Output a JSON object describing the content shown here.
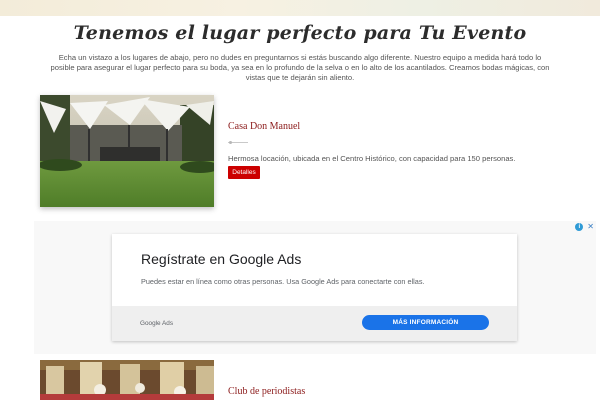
{
  "header": {
    "title": "Tenemos el lugar perfecto para Tu Evento",
    "intro": "Echa un vistazo a los lugares de abajo, pero no dudes en preguntarnos si estás buscando algo diferente. Nuestro equipo a medida hará todo lo posible para asegurar el lugar perfecto para su boda, ya sea en lo profundo de la selva o en lo alto de los acantilados. Creamos bodas mágicas, con vistas que te dejarán sin aliento."
  },
  "venues": [
    {
      "name": "Casa Don Manuel",
      "description": "Hermosa locación, ubicada en el Centro Histórico, con capacidad para 150 personas.",
      "button_label": "Detalles"
    },
    {
      "name": "Club de periodistas"
    }
  ],
  "ad": {
    "headline": "Regístrate en Google Ads",
    "body": "Puedes estar en línea como otras personas. Usa Google Ads para conectarte con ellas.",
    "source": "Google Ads",
    "cta": "MÁS INFORMACIÓN",
    "close_glyph": "✕",
    "choices_glyph": "i"
  },
  "colors": {
    "accent_red": "#cc0000",
    "venue_title": "#8b1a1a",
    "ad_cta_blue": "#1a73e8"
  },
  "icons": [
    "adchoices-icon",
    "close-icon"
  ]
}
